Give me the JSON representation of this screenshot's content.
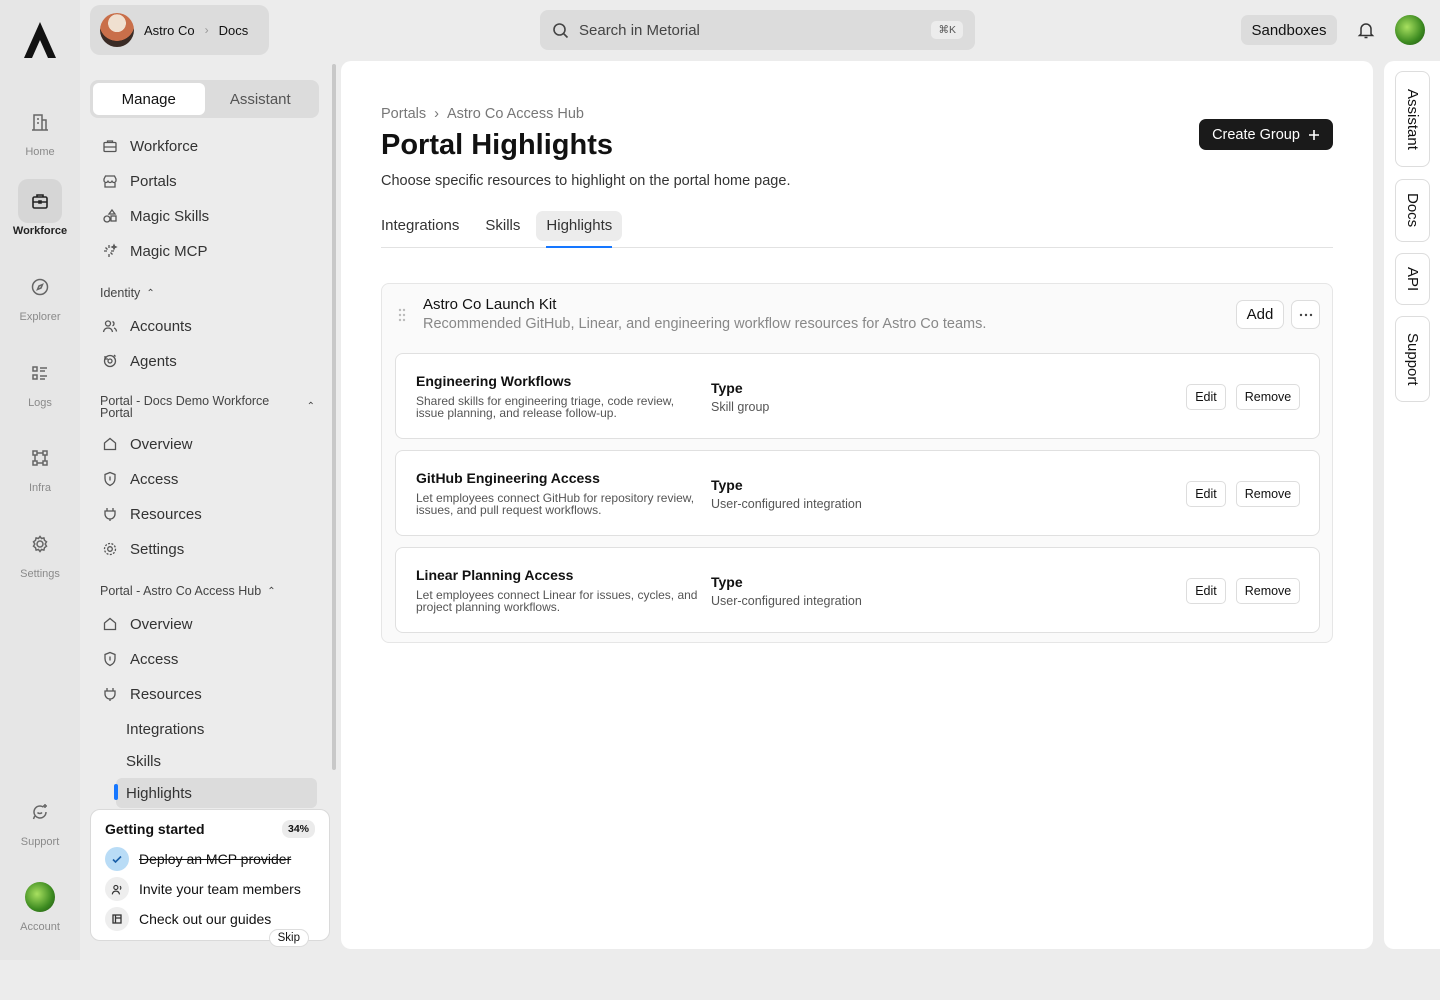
{
  "rail": {
    "items": [
      {
        "label": "Home",
        "icon": "building-icon"
      },
      {
        "label": "Workforce",
        "icon": "briefcase-icon",
        "active": true
      },
      {
        "label": "Explorer",
        "icon": "compass-icon"
      },
      {
        "label": "Logs",
        "icon": "list-icon"
      },
      {
        "label": "Infra",
        "icon": "network-icon"
      },
      {
        "label": "Settings",
        "icon": "gear-icon"
      },
      {
        "label": "Support",
        "icon": "chat-icon"
      },
      {
        "label": "Account",
        "icon": "avatar"
      }
    ]
  },
  "workspace": {
    "org": "Astro Co",
    "section": "Docs"
  },
  "search": {
    "placeholder": "Search in Metorial",
    "shortcut": "⌘K"
  },
  "topbar": {
    "sandboxes": "Sandboxes"
  },
  "sidebar": {
    "segments": [
      "Manage",
      "Assistant"
    ],
    "items": [
      {
        "label": "Workforce",
        "icon": "briefcase-icon"
      },
      {
        "label": "Portals",
        "icon": "storefront-icon"
      },
      {
        "label": "Magic Skills",
        "icon": "shapes-icon"
      },
      {
        "label": "Magic MCP",
        "icon": "sparkle-icon"
      }
    ],
    "identity": {
      "label": "Identity",
      "items": [
        {
          "label": "Accounts",
          "icon": "users-icon"
        },
        {
          "label": "Agents",
          "icon": "agent-icon"
        }
      ]
    },
    "portal_docs": {
      "label": "Portal - Docs Demo Workforce Portal",
      "items": [
        {
          "label": "Overview",
          "icon": "home-icon"
        },
        {
          "label": "Access",
          "icon": "shield-icon"
        },
        {
          "label": "Resources",
          "icon": "plug-icon"
        },
        {
          "label": "Settings",
          "icon": "gear-icon"
        }
      ]
    },
    "portal_astro": {
      "label": "Portal - Astro Co Access Hub",
      "items": [
        {
          "label": "Overview",
          "icon": "home-icon"
        },
        {
          "label": "Access",
          "icon": "shield-icon"
        },
        {
          "label": "Resources",
          "icon": "plug-icon"
        }
      ],
      "subitems": [
        "Integrations",
        "Skills",
        "Highlights"
      ]
    }
  },
  "getting_started": {
    "title": "Getting started",
    "progress": "34%",
    "tasks": [
      {
        "label": "Deploy an MCP provider",
        "done": true
      },
      {
        "label": "Invite your team members",
        "done": false
      },
      {
        "label": "Check out our guides",
        "done": false
      }
    ],
    "skip": "Skip"
  },
  "page": {
    "breadcrumb": [
      "Portals",
      "Astro Co Access Hub"
    ],
    "title": "Portal Highlights",
    "description": "Choose specific resources to highlight on the portal home page.",
    "create_button": "Create Group",
    "tabs": [
      "Integrations",
      "Skills",
      "Highlights"
    ]
  },
  "group": {
    "title": "Astro Co Launch Kit",
    "subtitle": "Recommended GitHub, Linear, and engineering workflow resources for Astro Co teams.",
    "add": "Add",
    "items": [
      {
        "name": "Engineering Workflows",
        "desc": "Shared skills for engineering triage, code review, issue planning, and release follow-up.",
        "type_label": "Type",
        "type": "Skill group",
        "edit": "Edit",
        "remove": "Remove"
      },
      {
        "name": "GitHub Engineering Access",
        "desc": "Let employees connect GitHub for repository review, issues, and pull request workflows.",
        "type_label": "Type",
        "type": "User-configured integration",
        "edit": "Edit",
        "remove": "Remove"
      },
      {
        "name": "Linear Planning Access",
        "desc": "Let employees connect Linear for issues, cycles, and project planning workflows.",
        "type_label": "Type",
        "type": "User-configured integration",
        "edit": "Edit",
        "remove": "Remove"
      }
    ]
  },
  "dock": [
    "Assistant",
    "Docs",
    "API",
    "Support"
  ]
}
